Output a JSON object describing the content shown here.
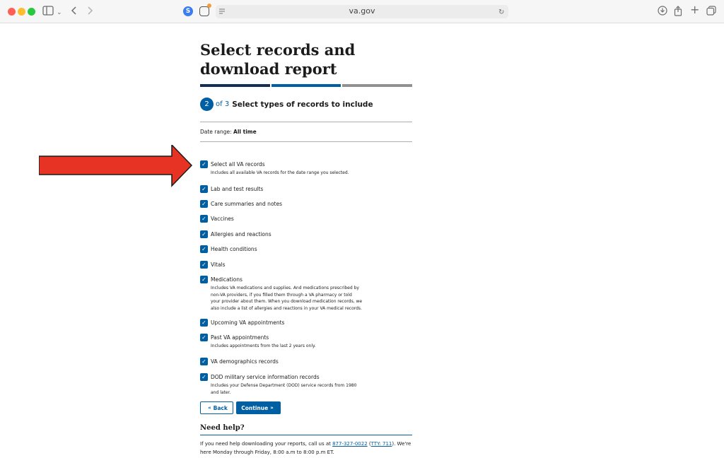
{
  "browser": {
    "url": "va.gov",
    "ext_s_label": "S"
  },
  "page": {
    "title": "Select records and download report",
    "step_number": "2",
    "step_of": "of 3",
    "step_title": "Select types of records to include",
    "progress": {
      "total_steps": 3,
      "current_step": 2
    },
    "date_range_label": "Date range:",
    "date_range_value": "All time",
    "checkboxes": [
      {
        "label": "Select all VA records",
        "description": "Includes all available VA records for the date range you selected.",
        "checked": true
      },
      {
        "label": "Lab and test results",
        "description": "",
        "checked": true
      },
      {
        "label": "Care summaries and notes",
        "description": "",
        "checked": true
      },
      {
        "label": "Vaccines",
        "description": "",
        "checked": true
      },
      {
        "label": "Allergies and reactions",
        "description": "",
        "checked": true
      },
      {
        "label": "Health conditions",
        "description": "",
        "checked": true
      },
      {
        "label": "Vitals",
        "description": "",
        "checked": true
      },
      {
        "label": "Medications",
        "description": "Includes VA medications and supplies. And medications prescribed by non-VA providers, if you filled them through a VA pharmacy or told your provider about them. When you download medication records, we also include a list of allergies and reactions in your VA medical records.",
        "checked": true
      },
      {
        "label": "Upcoming VA appointments",
        "description": "",
        "checked": true
      },
      {
        "label": "Past VA appointments",
        "description": "Includes appointments from the last 2 years only.",
        "checked": true
      },
      {
        "label": "VA demographics records",
        "description": "",
        "checked": true
      },
      {
        "label": "DOD military service information records",
        "description": "Includes your Defense Department (DOD) service records from 1980 and later.",
        "checked": true
      }
    ],
    "back_label": "Back",
    "continue_label": "Continue",
    "help": {
      "title": "Need help?",
      "text_before": "If you need help downloading your reports, call us at ",
      "phone": "877-327-0022",
      "text_mid": " (",
      "tty": "TTY: 711",
      "text_after": "). We're here Monday through Friday, 8:00 a.m to 8:00 p.m ET."
    }
  },
  "colors": {
    "primary": "#005ea2",
    "progress_done": "#162e51",
    "progress_todo": "#919191",
    "arrow": "#e63323"
  }
}
